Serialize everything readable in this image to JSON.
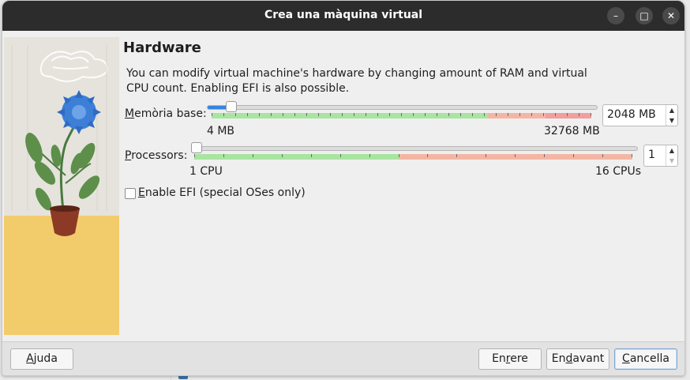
{
  "window": {
    "title": "Crea una màquina virtual",
    "controls": {
      "minimize": "–",
      "maximize": "□",
      "close": "✕"
    }
  },
  "page": {
    "heading": "Hardware",
    "description": "You can modify virtual machine's hardware by changing amount of RAM and virtual CPU count. Enabling EFI is also possible."
  },
  "memory": {
    "label_underlined": "M",
    "label_rest": "emòria base:",
    "min_label": "4 MB",
    "max_label": "32768 MB",
    "value": "2048 MB",
    "value_mb": 2048,
    "range": [
      4,
      32768
    ]
  },
  "processors": {
    "label_underlined": "P",
    "label_rest": "rocessors:",
    "min_label": "1 CPU",
    "max_label": "16 CPUs",
    "value": "1",
    "range": [
      1,
      16
    ]
  },
  "efi": {
    "label_underlined": "E",
    "label_rest": "nable EFI (special OSes only)",
    "checked": false
  },
  "buttons": {
    "help_u": "A",
    "help_rest": "juda",
    "back_pre": "En",
    "back_u": "r",
    "back_post": "ere",
    "next_pre": "En",
    "next_u": "d",
    "next_post": "avant",
    "cancel_u": "C",
    "cancel_rest": "ancella"
  },
  "colors": {
    "titlebar": "#2c2c2c",
    "accent": "#3584e4",
    "range_green": "#a8e5a0",
    "range_orange": "#f4b6a4",
    "range_red": "#f0a0a0",
    "art_sand": "#f2cc6b",
    "flower_blue": "#3d7fd6"
  }
}
